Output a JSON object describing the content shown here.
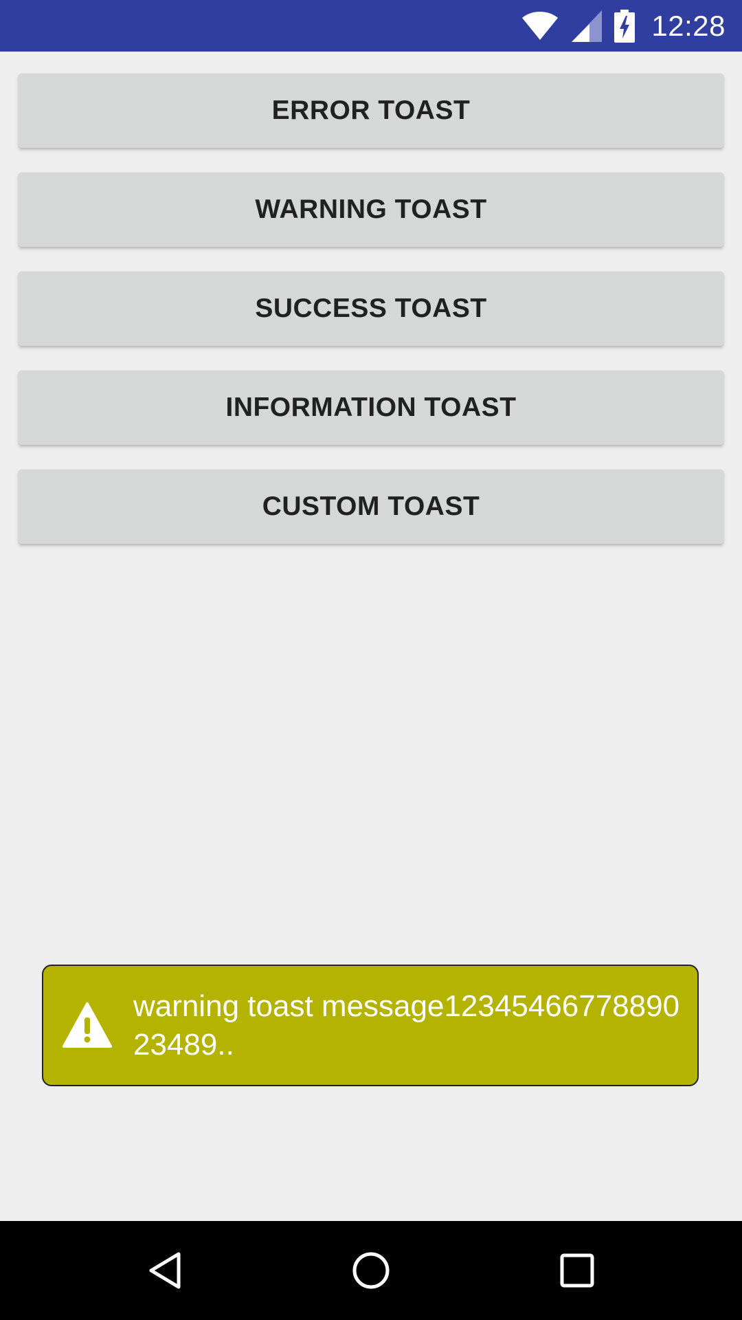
{
  "status_bar": {
    "time": "12:28",
    "icons": [
      "wifi-icon",
      "signal-icon",
      "battery-charging-icon"
    ],
    "color": "#303f9f"
  },
  "buttons": [
    {
      "label": "ERROR TOAST"
    },
    {
      "label": "WARNING TOAST"
    },
    {
      "label": "SUCCESS TOAST"
    },
    {
      "label": "INFORMATION TOAST"
    },
    {
      "label": "CUSTOM TOAST"
    }
  ],
  "toast": {
    "icon": "warning-icon",
    "message": "warning toast message12345466778890234​89..",
    "color": "#b4b400"
  },
  "nav_bar": {
    "icons": [
      "back-icon",
      "home-icon",
      "recents-icon"
    ]
  }
}
